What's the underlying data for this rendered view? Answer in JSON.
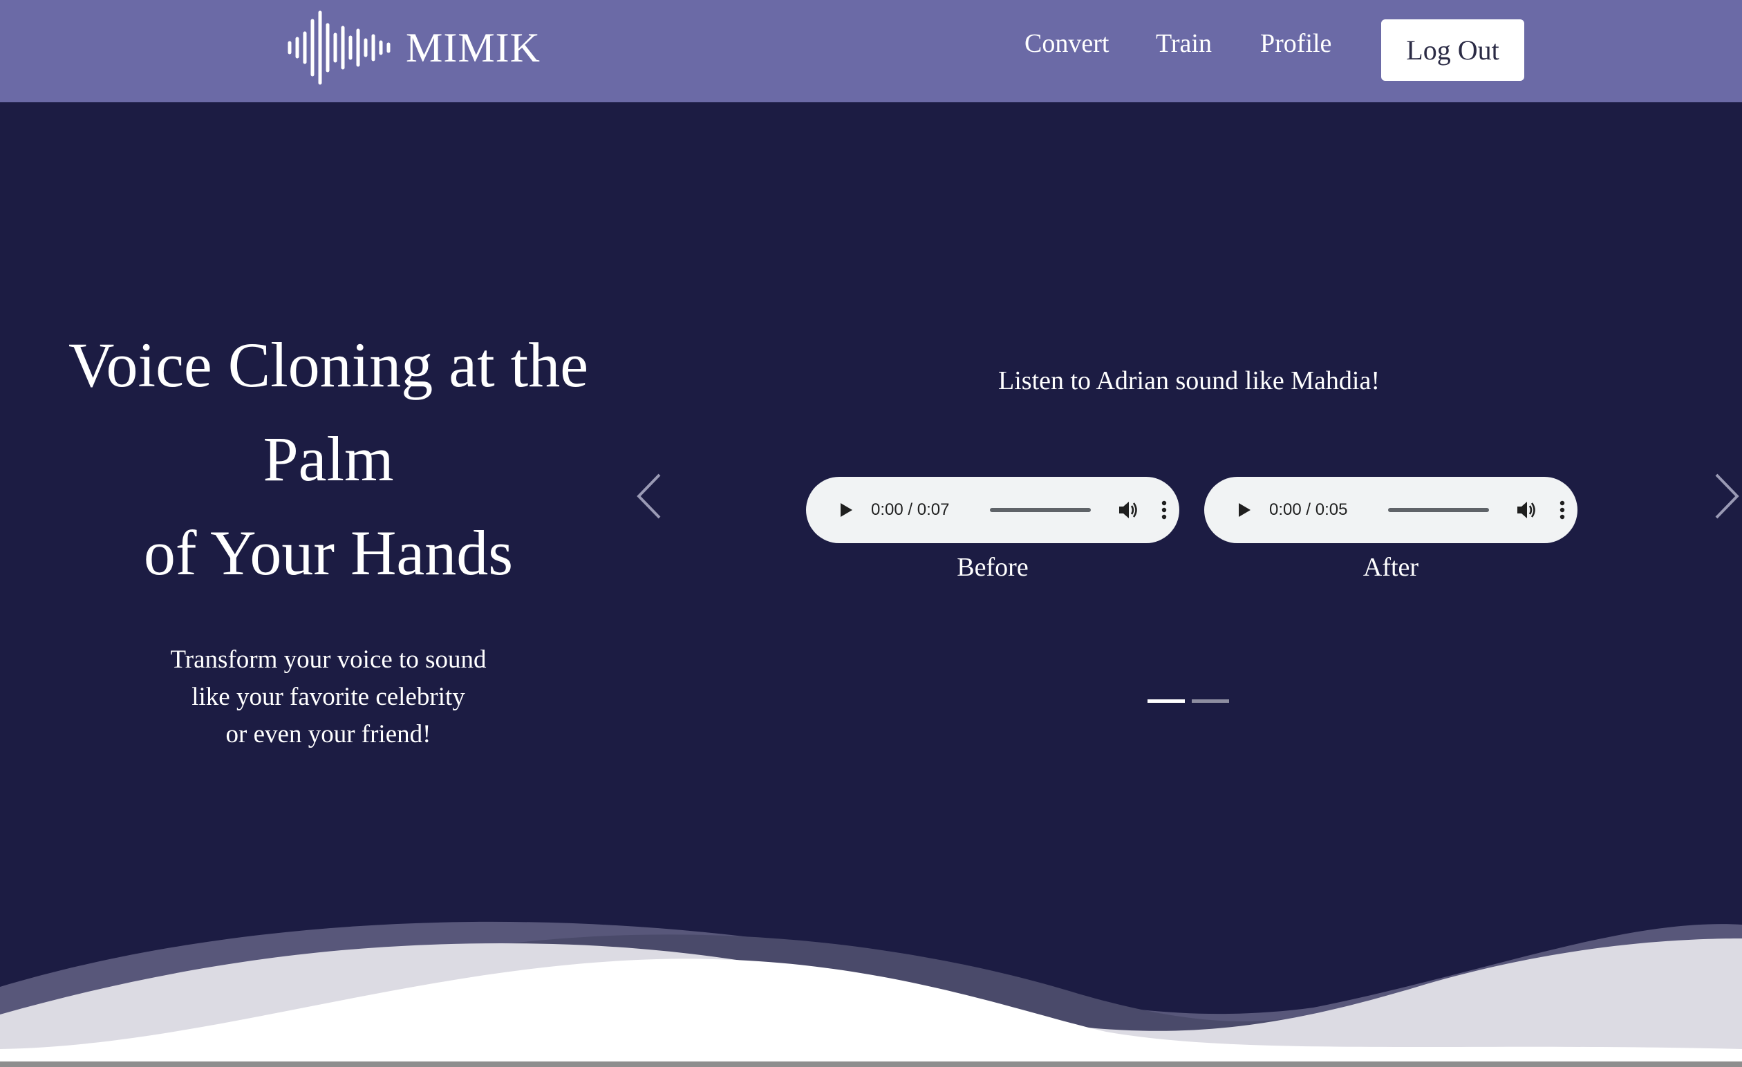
{
  "header": {
    "brand": "MIMIK",
    "nav": {
      "convert": "Convert",
      "train": "Train",
      "profile": "Profile"
    },
    "logout_label": "Log Out"
  },
  "hero": {
    "title_line1": "Voice Cloning at the Palm",
    "title_line2": "of Your Hands",
    "subtitle_line1": "Transform your voice to sound",
    "subtitle_line2": "like your favorite celebrity",
    "subtitle_line3": "or even your friend!"
  },
  "carousel": {
    "caption": "Listen to Adrian sound like Mahdia!",
    "before": {
      "time": "0:00 / 0:07",
      "progress": 0,
      "label": "Before"
    },
    "after": {
      "time": "0:00 / 0:05",
      "progress": 0,
      "label": "After"
    },
    "slide_count": 2,
    "active_slide": 1
  },
  "icons": {
    "logo": "soundwave-icon",
    "prev": "chevron-left-icon",
    "next": "chevron-right-icon",
    "play": "play-icon",
    "volume": "volume-icon",
    "more": "more-vertical-icon"
  },
  "colors": {
    "navbar": "#6b6aa6",
    "hero_background": "#1c1c43",
    "player_background": "#f1f3f4",
    "wave_light": "#dcdbe3",
    "wave_mid": "#8a89a8",
    "wave_dark": "#4a4a6a"
  }
}
